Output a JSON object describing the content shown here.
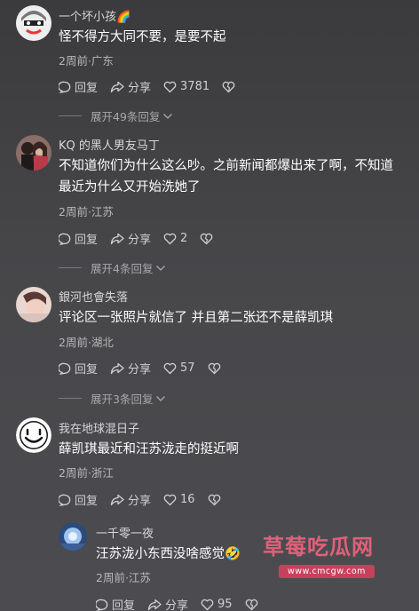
{
  "comments": [
    {
      "username": "一个坏小孩🌈",
      "text": "怪不得方大同不要，是要不起",
      "meta": "2周前·广东",
      "reply_label": "回复",
      "share_label": "分享",
      "likes": "3781",
      "expand_label": "展开49条回复"
    },
    {
      "username": "KQ 的黑人男友马丁",
      "text_line1": "不知道你们为什么这么吵。之前新闻都爆出来了啊，不知道",
      "text_line2": "最近为什么又开始洗她了",
      "meta": "2周前·江苏",
      "reply_label": "回复",
      "share_label": "分享",
      "likes": "2",
      "expand_label": "展开4条回复"
    },
    {
      "username": "銀河也會失落",
      "text": "评论区一张照片就信了 并且第二张还不是薛凯琪",
      "meta": "2周前·湖北",
      "reply_label": "回复",
      "share_label": "分享",
      "likes": "57",
      "expand_label": "展开3条回复"
    },
    {
      "username": "我在地球混日子",
      "text": "薛凯琪最近和汪苏泷走的挺近啊",
      "meta": "2周前·浙江",
      "reply_label": "回复",
      "share_label": "分享",
      "likes": "16"
    }
  ],
  "reply": {
    "username": "一千零一夜",
    "text": "汪苏泷小东西没啥感觉🤣",
    "meta": "2周前·江苏",
    "reply_label": "回复",
    "share_label": "分享",
    "likes": "95"
  },
  "watermark": {
    "title": "草莓吃瓜网",
    "url": "www.cmcgw.com"
  },
  "colors": {
    "background": "#444446",
    "watermark_accent": "#e0607a"
  }
}
